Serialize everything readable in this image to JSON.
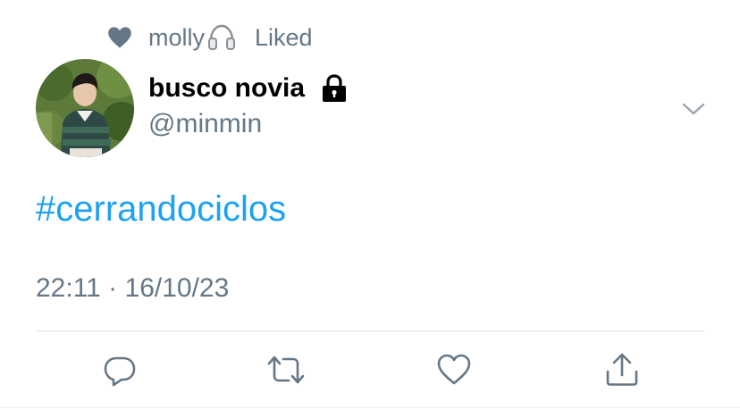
{
  "social_context": {
    "liker_name": "molly",
    "liker_emoji": "headphones-icon",
    "action_label": "Liked"
  },
  "author": {
    "display_name": "busco novia",
    "handle": "@minmin",
    "protected": true
  },
  "tweet": {
    "text": "#cerrandociclos",
    "timestamp": "22:11 · 16/10/23"
  },
  "actions": [
    {
      "name": "reply",
      "icon": "reply-icon"
    },
    {
      "name": "retweet",
      "icon": "retweet-icon"
    },
    {
      "name": "like",
      "icon": "heart-icon"
    },
    {
      "name": "share",
      "icon": "share-icon"
    }
  ],
  "colors": {
    "link": "#1da1f2",
    "secondary_text": "#657786",
    "icon": "#657786",
    "divider": "#dfe3e6"
  }
}
